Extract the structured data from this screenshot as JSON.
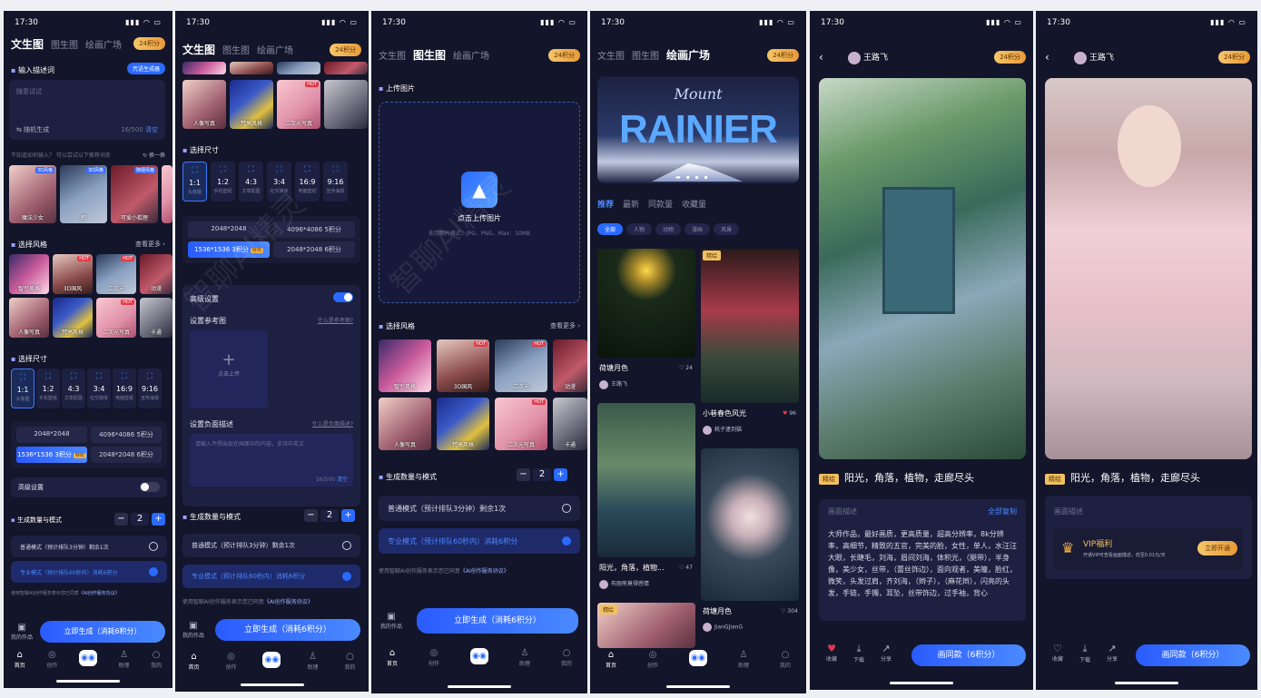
{
  "status": {
    "time": "17:30"
  },
  "tabs": {
    "t2i": "文生图",
    "i2i": "图生图",
    "plaza": "绘画广场"
  },
  "points": "24积分",
  "watermark": "智聊AI精灵",
  "screen1": {
    "input_title": "输入描述词",
    "generator_btn": "咒语生成器",
    "input_placeholder": "随意试试",
    "random": "随机生成",
    "counter": "16/500",
    "clear": "清空",
    "hint": "不知道如何输入？ 可以尝试以下推荐词条",
    "refresh": "换一换",
    "recommend": [
      {
        "label": "魔法少女",
        "badge": "3D风格"
      },
      {
        "label": "鹤",
        "badge": "3D风格"
      },
      {
        "label": "可爱小狐狸",
        "badge": "随便风格"
      }
    ],
    "style_title": "选择风格",
    "more": "查看更多",
    "size_title": "选择尺寸",
    "advanced": "高级设置",
    "gen_title": "生成数量与模式",
    "qty": "2",
    "mode_normal": "普通模式（预计排队3分钟）剩余1次",
    "mode_pro": "专业模式（预计排队60秒内）消耗6积分",
    "agree": "使用智聊AI创作服务表示您已同意",
    "agree_link": "《AI创作服务协议》",
    "works": "我的作品",
    "gen_btn": "立即生成（消耗6积分）"
  },
  "styles": [
    {
      "label": "智引风格",
      "hot": false
    },
    {
      "label": "3D国风",
      "hot": true
    },
    {
      "label": "二次元",
      "hot": true
    },
    {
      "label": "动漫",
      "hot": false
    },
    {
      "label": "人像写真",
      "hot": false
    },
    {
      "label": "梵高风格",
      "hot": false
    },
    {
      "label": "二次元写真",
      "hot": true
    },
    {
      "label": "卡通",
      "hot": false
    }
  ],
  "ratios": [
    {
      "r": "1:1",
      "sub": "头像图"
    },
    {
      "r": "1:2",
      "sub": "手机壁纸"
    },
    {
      "r": "4:3",
      "sub": "文章配图"
    },
    {
      "r": "3:4",
      "sub": "社交媒体"
    },
    {
      "r": "16:9",
      "sub": "电脑壁纸"
    },
    {
      "r": "9:16",
      "sub": "宣传海报"
    }
  ],
  "resolutions": [
    {
      "label": "2048*2048",
      "extra": ""
    },
    {
      "label": "4096*4086",
      "extra": "5积分"
    },
    {
      "label": "1536*1536",
      "extra": "3积分"
    },
    {
      "label": "2048*2048",
      "extra": "6积分"
    }
  ],
  "vip": "特权",
  "screen2": {
    "advanced": "高级设置",
    "ref_title": "设置参考图",
    "ref_help": "什么是参考图?",
    "upload": "点击上传",
    "neg_title": "设置负面描述",
    "neg_help": "什么是负面描述?",
    "neg_placeholder": "请输入不想出现在画面中的内容，支持中英文",
    "counter": "16/500",
    "clear": "清空"
  },
  "screen3": {
    "upload_title": "上传图片",
    "upload_btn": "点击上传图片",
    "upload_hint": "支持图片格式：JPG、PNG，Max：10MB"
  },
  "screen4": {
    "banner_word": "RAINIER",
    "banner_script": "Mount",
    "sections": [
      "推荐",
      "最新",
      "同款量",
      "收藏量"
    ],
    "filters": [
      "全部",
      "人物",
      "动物",
      "漫画",
      "风景"
    ],
    "cards": [
      {
        "title": "荷塘月色",
        "user": "王路飞",
        "likes": "24",
        "fine": false
      },
      {
        "title": "小巷春色风光",
        "user": "耗子逮到猫",
        "likes": "96",
        "fine": true
      },
      {
        "title": "阳光，角落，植物...",
        "user": "布丽熊莫得感情",
        "likes": "47",
        "fine": false
      },
      {
        "title": "荷塘月色",
        "user": "JianGJianG",
        "likes": "304",
        "fine": false
      }
    ],
    "fine_label": "精绘"
  },
  "detail": {
    "user": "王路飞",
    "fine": "精绘",
    "caption": "阳光，角落，植物，走廊尽头",
    "desc_title": "画面描述",
    "copy_all": "全部复制",
    "desc": "大师作品，最好画质，更高质量，超高分辨率，8k分辨率，高细节，精致的五官，完美的脸，女性，单人，水汪汪大眼，长睫毛，刘海，眉间刘海，体积光，（腿带），半身像，美少女，丝带，（蕾丝饰边），面向观者，美瞳，脸红，微笑，头发过肩，齐刘海，（辫子），（麻花辫），闪亮的头发，手链，手镯，耳坠，丝带饰边，过手袖，背心",
    "fav": "收藏",
    "download": "下载",
    "share": "分享",
    "same_btn": "画同款（6积分）",
    "vip_title": "VIP福利",
    "vip_desc": "开通VIP可查看画面描述，低至0.01元/天",
    "vip_btn": "立即开通"
  },
  "nav": {
    "home": "首页",
    "create": "创作",
    "assist": "助理",
    "mine": "我的"
  }
}
